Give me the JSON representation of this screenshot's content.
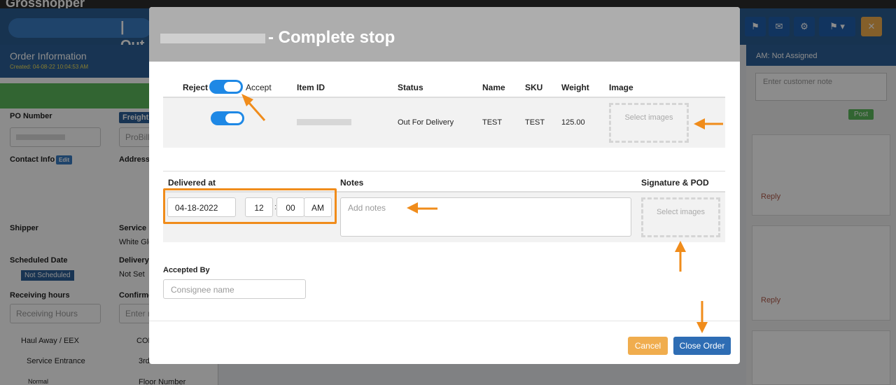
{
  "app": {
    "brand": "Grosshopper",
    "page_title": "| Out",
    "order_info": "Order Information",
    "created": "Created: 04-08-22 10:04:53 AM"
  },
  "left_form": {
    "po_number": "PO Number",
    "freight": "Freight #",
    "probill": "ProBill",
    "contact_info": "Contact Info",
    "edit": "Edit",
    "address": "Address",
    "shipper": "Shipper",
    "service_level": "Service L",
    "white_glove": "White Glo",
    "scheduled_date": "Scheduled Date",
    "not_scheduled": "Not Scheduled",
    "delivery": "Delivery",
    "not_set": "Not Set",
    "receiving_hours": "Receiving hours",
    "receiving_placeholder": "Receiving Hours",
    "confirmed": "Confirme",
    "enter": "Enter r",
    "haul_away": "Haul Away / EEX",
    "cod": "COD",
    "service_entrance": "Service Entrance",
    "three_crew": "3rd",
    "normal": "Normal",
    "floor_number": "Floor Number"
  },
  "right_panel": {
    "assignee": "AM: Not Assigned",
    "note_placeholder": "Enter customer note",
    "post": "Post",
    "reply": "Reply"
  },
  "modal": {
    "title_suffix": "- Complete stop",
    "headers": {
      "reject": "Reject",
      "accept": "Accept",
      "item_id": "Item ID",
      "status": "Status",
      "name": "Name",
      "sku": "SKU",
      "weight": "Weight",
      "image": "Image"
    },
    "row": {
      "status": "Out For Delivery",
      "name": "TEST",
      "sku": "TEST",
      "weight": "125.00",
      "select_images": "Select images"
    },
    "delivered_at": "Delivered at",
    "notes_label": "Notes",
    "signature_label": "Signature & POD",
    "date": "04-18-2022",
    "hour": "12",
    "minute": "00",
    "ampm": "AM",
    "notes_placeholder": "Add notes",
    "pod_select": "Select images",
    "accepted_by": "Accepted By",
    "consignee_placeholder": "Consignee name",
    "cancel": "Cancel",
    "close_order": "Close Order"
  },
  "colors": {
    "accent": "#f08c1b",
    "primary": "#2e6db4",
    "cancel": "#f0ad4e",
    "toggle": "#1e88e5"
  }
}
